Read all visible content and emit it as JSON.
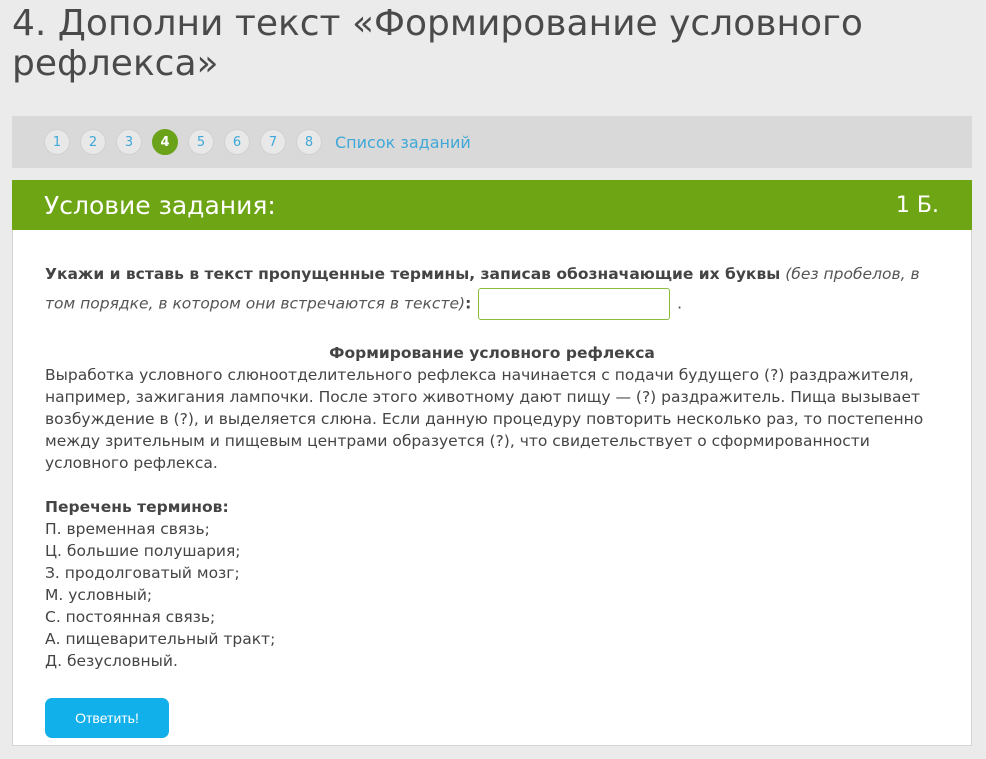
{
  "page": {
    "title": "4. Дополни текст «Формирование условного рефлекса»"
  },
  "nav": {
    "items": [
      "1",
      "2",
      "3",
      "4",
      "5",
      "6",
      "7",
      "8"
    ],
    "active_index": 3,
    "task_list_label": "Список заданий"
  },
  "task": {
    "header_title": "Условие задания:",
    "points": "1 Б.",
    "instruction_bold": "Укажи и вставь в текст пропущенные термины, записав обозначающие их буквы",
    "instruction_italic": "(без пробелов, в том порядке, в котором они встречаются в тексте)",
    "instruction_colon": ":",
    "answer_value": "",
    "answer_suffix": ".",
    "text_title": "Формирование условного рефлекса",
    "text_paragraph": "Выработка условного слюноотделительного рефлекса начинается с подачи будущего (?) раздражителя, например, зажигания лампочки. После этого животному дают пищу — (?)  раздражитель. Пища вызывает возбуждение в (?), и выделяется слюна. Если данную процедуру повторить несколько раз, то постепенно между зрительным и пищевым центрами образуется (?), что свидетельствует о сформированности условного рефлекса.",
    "terms_heading": "Перечень терминов:",
    "terms": [
      "П. временная связь;",
      "Ц. большие полушария;",
      "З. продолговатый мозг;",
      "М. условный;",
      "С. постоянная связь;",
      "А. пищеварительный тракт;",
      "Д. безусловный."
    ],
    "submit_label": "Ответить!"
  },
  "colors": {
    "accent_green": "#6ea514",
    "link_blue": "#3fa8d8",
    "button_blue": "#12b0ea"
  }
}
